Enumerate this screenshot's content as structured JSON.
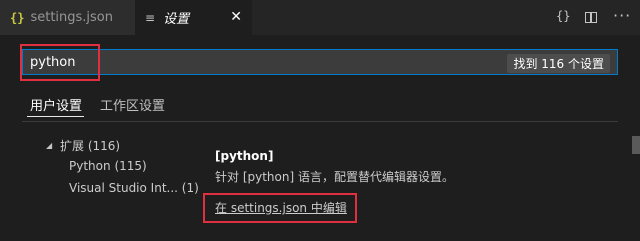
{
  "tabs": {
    "inactive": {
      "icon": "json-braces-icon",
      "glyph": "{}",
      "label": "settings.json"
    },
    "active": {
      "icon": "settings-list-icon",
      "glyph": "≡",
      "label": "设置",
      "close_glyph": "✕"
    }
  },
  "editor_actions": [
    {
      "name": "open-json-icon",
      "glyph": "{}"
    },
    {
      "name": "split-editor-icon",
      "glyph": ""
    },
    {
      "name": "more-actions-icon",
      "glyph": "···"
    }
  ],
  "search": {
    "value": "python",
    "result_count": "找到 116 个设置"
  },
  "scopes": {
    "user": "用户设置",
    "workspace": "工作区设置"
  },
  "toc": {
    "extensions": {
      "label": "扩展",
      "count": "(116)"
    },
    "python": {
      "label": "Python",
      "count": "(115)"
    },
    "vscode": {
      "label": "Visual Studio Int...",
      "count": "(1)"
    }
  },
  "setting": {
    "title": "[python]",
    "description": "针对 [python] 语言，配置替代编辑器设置。",
    "edit_link": "在 settings.json 中编辑"
  },
  "colors": {
    "accent": "#007acc",
    "highlight": "#e0303f",
    "json_icon": "#cbcb41"
  }
}
